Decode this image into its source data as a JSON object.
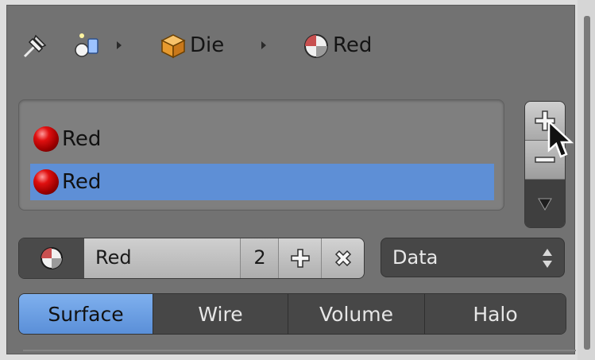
{
  "breadcrumb": {
    "items": [
      {
        "icon": "pin-icon"
      },
      {
        "icon": "object-data-icon"
      },
      {
        "icon": "mesh-cube-icon",
        "label": "Die"
      },
      {
        "icon": "material-sphere-icon",
        "label": "Red"
      }
    ]
  },
  "material_slots": [
    {
      "label": "Red",
      "selected": false
    },
    {
      "label": "Red",
      "selected": true
    }
  ],
  "slot_buttons": {
    "add": "add-slot",
    "remove": "remove-slot",
    "menu": "slot-specials-menu"
  },
  "material": {
    "name": "Red",
    "users": "2"
  },
  "link_select": {
    "value": "Data"
  },
  "tabs": [
    {
      "label": "Surface",
      "active": true
    },
    {
      "label": "Wire",
      "active": false
    },
    {
      "label": "Volume",
      "active": false
    },
    {
      "label": "Halo",
      "active": false
    }
  ],
  "colors": {
    "selection": "#5e8fd6",
    "panel": "#727272",
    "material_red": "#d01010"
  }
}
